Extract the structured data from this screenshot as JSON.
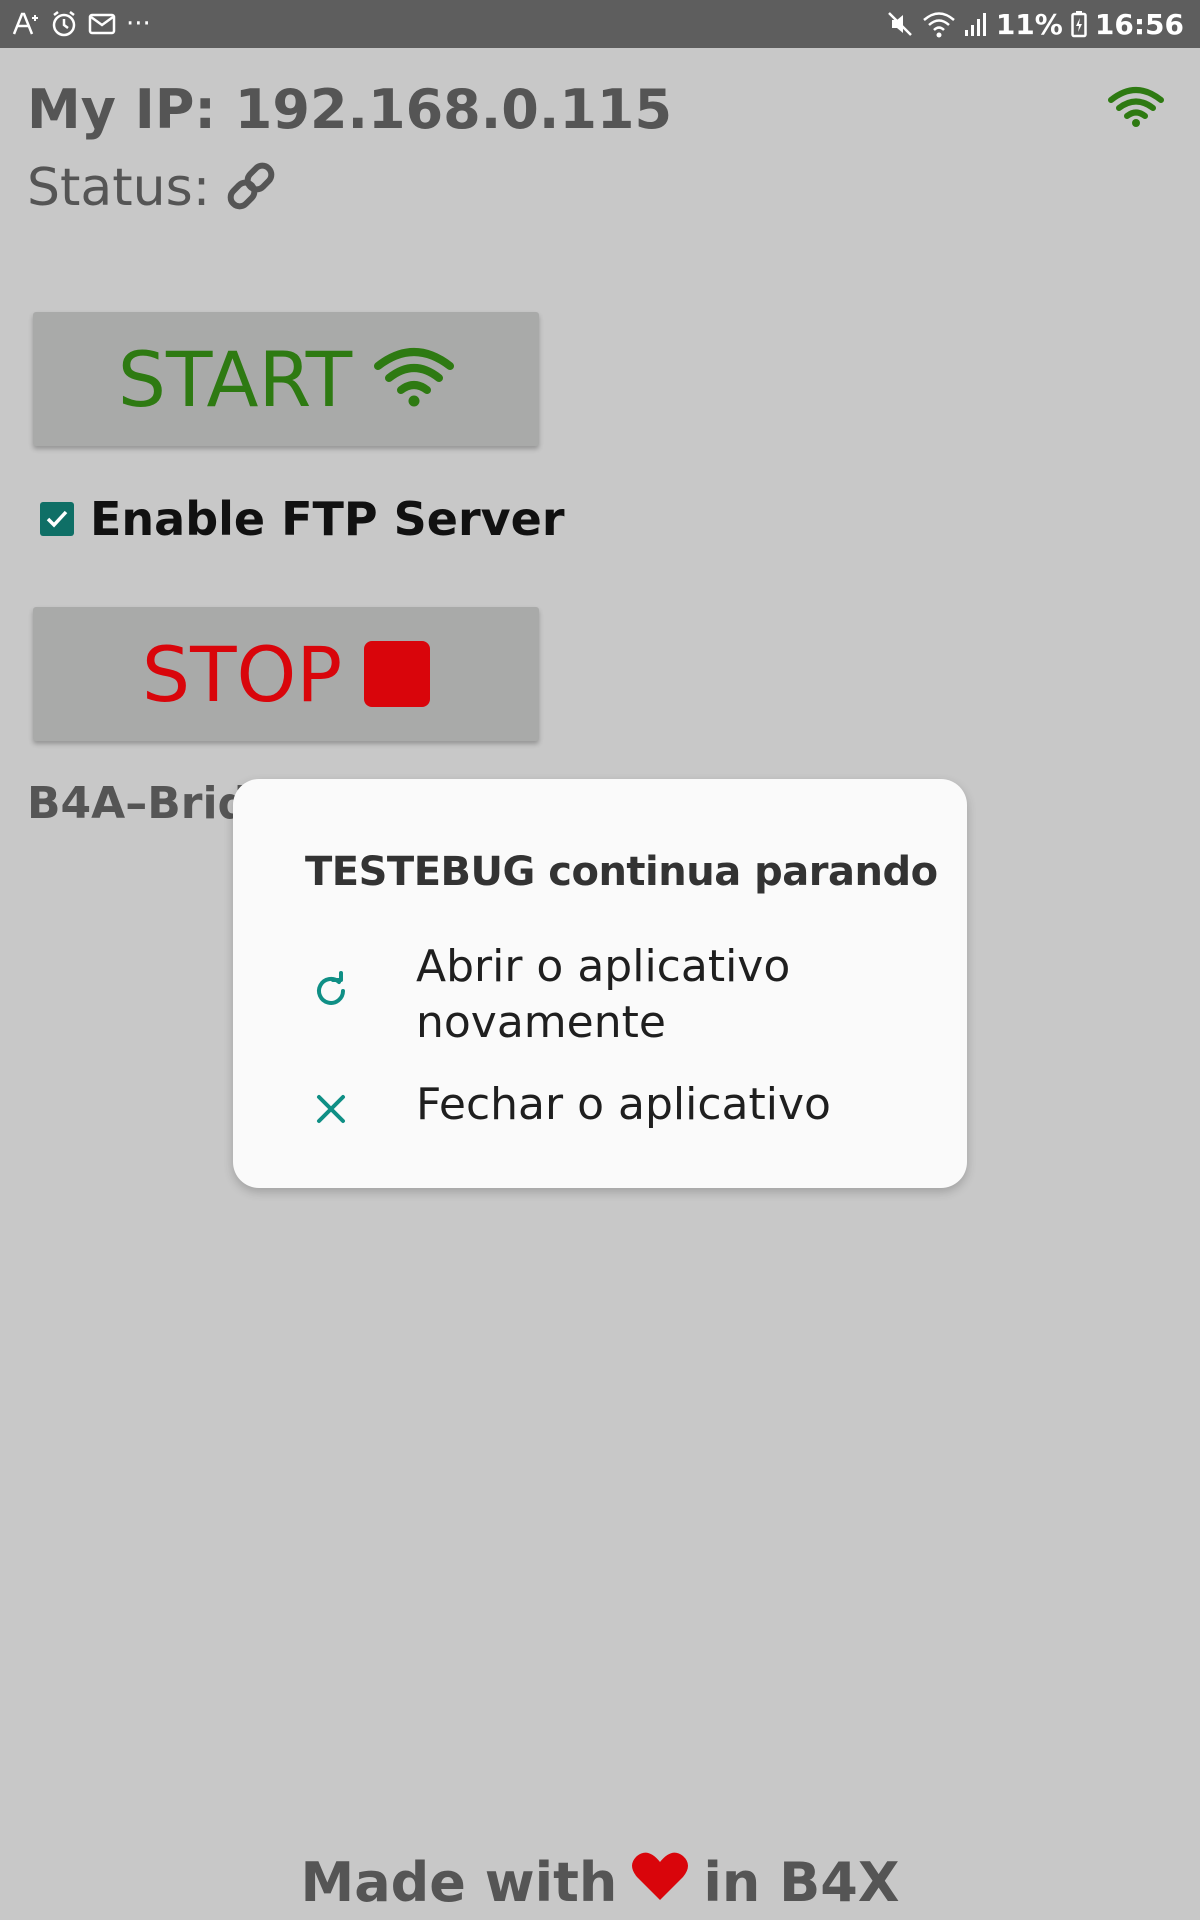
{
  "status_bar": {
    "left_icons": [
      "font-size-icon",
      "alarm-icon",
      "mail-icon"
    ],
    "more_glyph": "···",
    "battery_percent": "11%",
    "time": "16:56",
    "right_icons": [
      "mute-icon",
      "wifi-icon",
      "signal-icon",
      "battery-charging-icon"
    ]
  },
  "main": {
    "ip_label": "My IP: 192.168.0.115",
    "status_label": "Status:",
    "status_icon": "link-icon",
    "start_button_label": "START",
    "stop_button_label": "STOP",
    "checkbox_label": "Enable FTP Server",
    "checkbox_checked": true,
    "bridge_text": "B4A–Brid"
  },
  "dialog": {
    "title": "TESTEBUG continua parando",
    "options": [
      {
        "label": "Abrir o aplicativo novamente",
        "icon": "refresh-icon"
      },
      {
        "label": "Fechar o aplicativo",
        "icon": "close-icon"
      }
    ]
  },
  "footer": {
    "prefix": "Made with",
    "suffix": "in B4X",
    "icon": "heart-icon"
  },
  "colors": {
    "background": "#c8c8c8",
    "status_bar": "#5e5e5e",
    "start_green": "#2e7a12",
    "stop_red": "#d9050b",
    "accent_teal": "#0f8f85",
    "checkbox_teal": "#0f6f66",
    "dialog_bg": "#fafafa",
    "heart_red": "#d9050b"
  }
}
